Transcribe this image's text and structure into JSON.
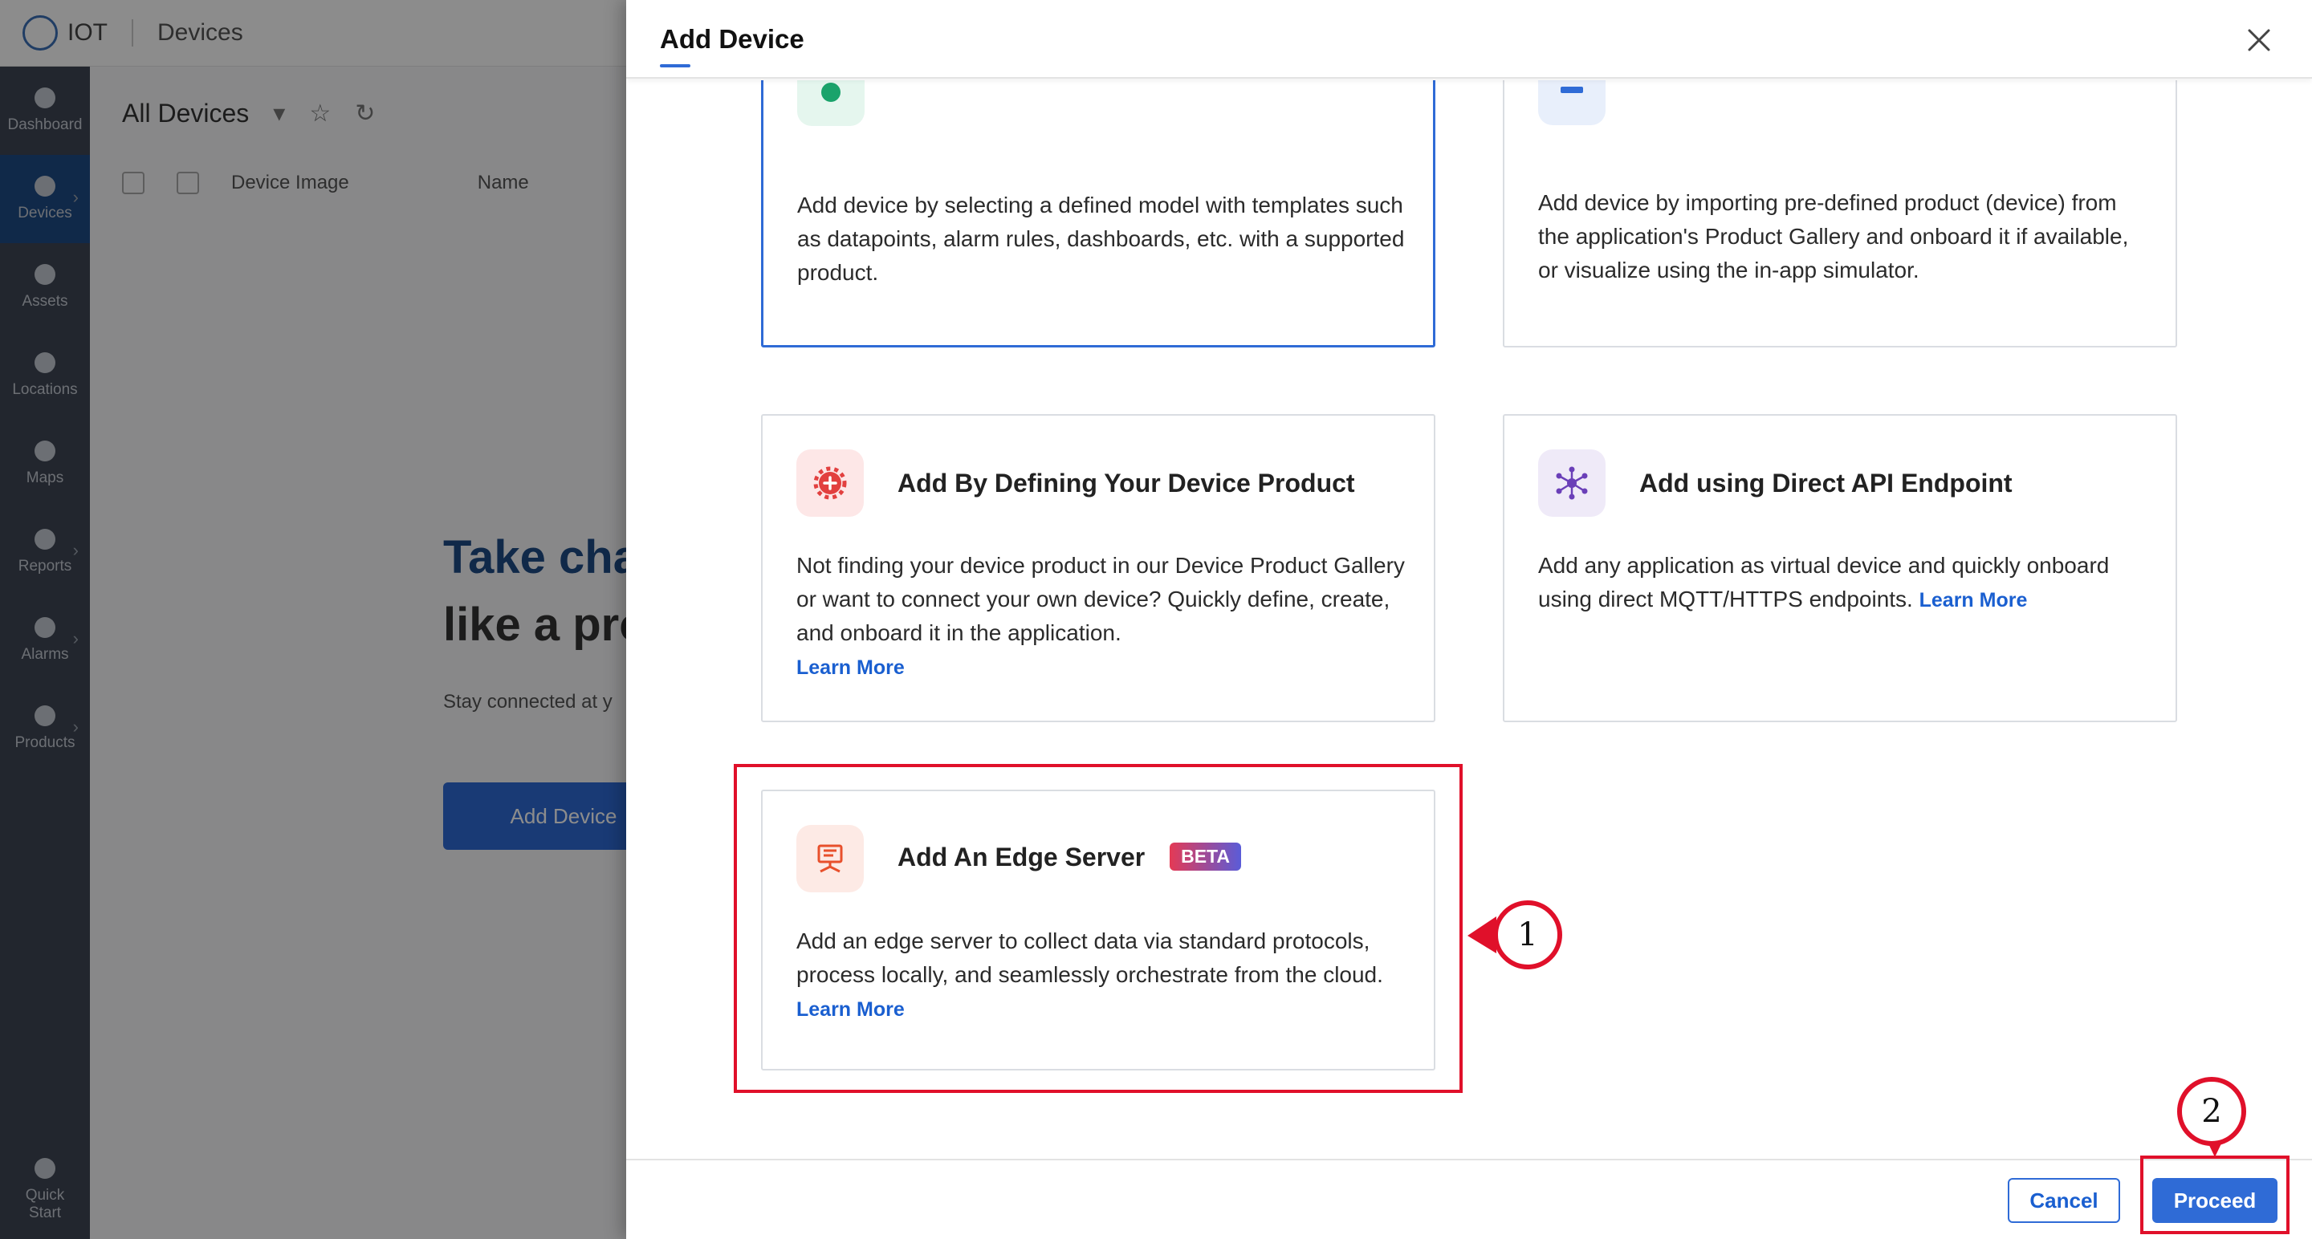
{
  "app": {
    "brand": "IOT",
    "section": "Devices",
    "sidebar": [
      {
        "label": "Dashboard",
        "icon": "dashboard-icon",
        "chevron": false
      },
      {
        "label": "Devices",
        "icon": "devices-icon",
        "chevron": true,
        "active": true
      },
      {
        "label": "Assets",
        "icon": "bulb-icon",
        "chevron": false
      },
      {
        "label": "Locations",
        "icon": "location-icon",
        "chevron": false
      },
      {
        "label": "Maps",
        "icon": "map-pin-icon",
        "chevron": false
      },
      {
        "label": "Reports",
        "icon": "reports-icon",
        "chevron": true
      },
      {
        "label": "Alarms",
        "icon": "bell-icon",
        "chevron": true
      },
      {
        "label": "Products",
        "icon": "box-icon",
        "chevron": true
      }
    ],
    "quick_start": {
      "label_line1": "Quick",
      "label_line2": "Start"
    },
    "main": {
      "heading": "All Devices",
      "columns": {
        "image": "Device Image",
        "name": "Name"
      },
      "hero_line1": "Take cha",
      "hero_line2": "like a pro",
      "subtext": "Stay connected at y",
      "add_button": "Add Device"
    }
  },
  "drawer": {
    "title": "Add Device",
    "cards": {
      "model": {
        "description": "Add device by selecting a defined model with templates such as datapoints, alarm rules, dashboards, etc. with a supported product."
      },
      "gallery": {
        "description": "Add device by importing pre-defined product (device) from the application's Product Gallery and onboard it if available, or visualize using the in-app simulator."
      },
      "define": {
        "title": "Add By Defining Your Device Product",
        "description": "Not finding your device product in our Device Product Gallery or want to connect your own device? Quickly define, create, and onboard it in the application.",
        "learn_more": "Learn More"
      },
      "api": {
        "title": "Add using Direct API Endpoint",
        "description": "Add any application as virtual device and quickly onboard using direct MQTT/HTTPS endpoints.",
        "learn_more": "Learn More"
      },
      "edge": {
        "title": "Add An Edge Server",
        "badge": "BETA",
        "description": "Add an edge server to collect data via standard protocols, process locally, and seamlessly orchestrate from the cloud.",
        "learn_more": "Learn More"
      }
    },
    "footer": {
      "cancel": "Cancel",
      "proceed": "Proceed"
    }
  },
  "annotations": {
    "marker1": "1",
    "marker2": "2"
  },
  "colors": {
    "accent": "#2f6bd6",
    "annotation_red": "#e0102a",
    "sidebar_bg": "#3f4654"
  }
}
